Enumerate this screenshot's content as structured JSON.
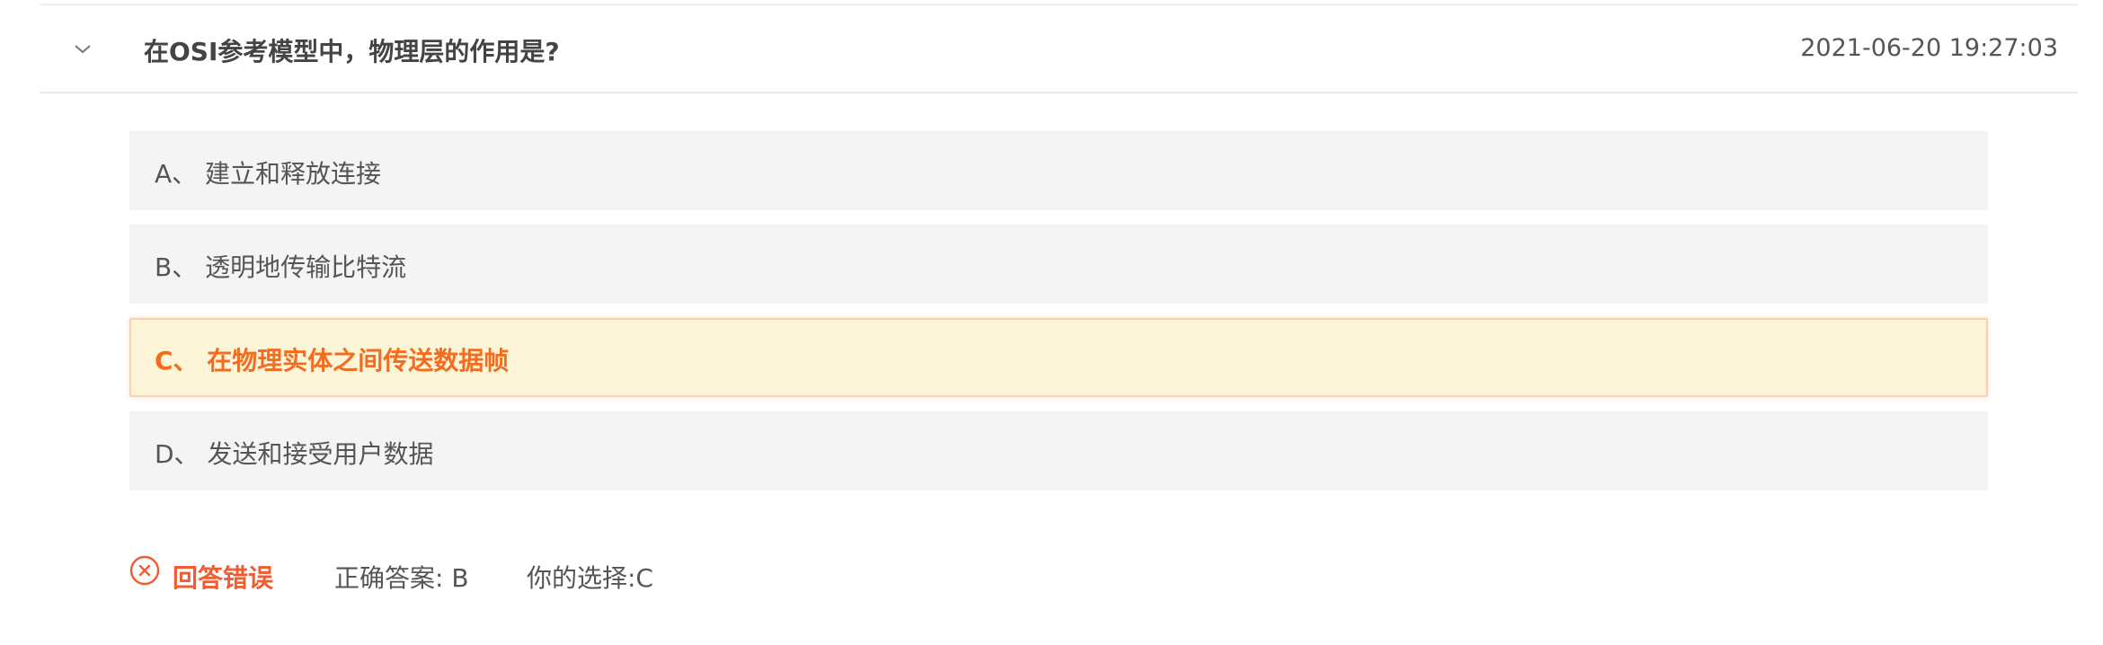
{
  "question": {
    "title": "在OSI参考模型中，物理层的作用是?",
    "timestamp": "2021-06-20 19:27:03"
  },
  "options": [
    {
      "text": "A、 建立和释放连接",
      "selected": false
    },
    {
      "text": "B、 透明地传输比特流",
      "selected": false
    },
    {
      "text": "C、 在物理实体之间传送数据帧",
      "selected": true
    },
    {
      "text": "D、 发送和接受用户数据",
      "selected": false
    }
  ],
  "result": {
    "status_label": "回答错误",
    "correct_answer": "正确答案: B",
    "your_choice": "你的选择:C"
  },
  "icons": {
    "collapse": "chevron-down-icon",
    "wrong": "close-circle-icon"
  },
  "colors": {
    "wrong_red": "#f15c30",
    "selected_orange": "#f36c1f",
    "selected_bg": "#fdf5d8",
    "option_bg": "#f4f4f4"
  }
}
